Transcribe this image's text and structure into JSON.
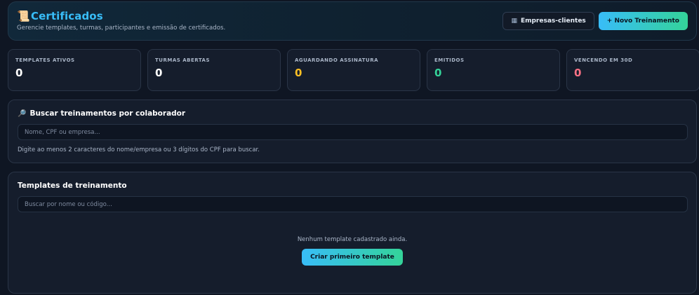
{
  "header": {
    "icon": "scroll-icon",
    "title": "Certificados",
    "subtitle": "Gerencie templates, turmas, participantes e emissão de certificados.",
    "clients_button_icon": "building-icon",
    "clients_button": "Empresas-clientes",
    "new_training_button": "+ Novo Treinamento"
  },
  "stats": [
    {
      "label": "TEMPLATES ATIVOS",
      "value": "0",
      "color": "#ffffff"
    },
    {
      "label": "TURMAS ABERTAS",
      "value": "0",
      "color": "#ffffff"
    },
    {
      "label": "AGUARDANDO ASSINATURA",
      "value": "0",
      "color": "#fbbf24"
    },
    {
      "label": "EMITIDOS",
      "value": "0",
      "color": "#34d399"
    },
    {
      "label": "VENCENDO EM 30D",
      "value": "0",
      "color": "#fb7185"
    }
  ],
  "search": {
    "icon": "magnifier-icon",
    "title": "Buscar treinamentos por colaborador",
    "placeholder": "Nome, CPF ou empresa...",
    "hint": "Digite ao menos 2 caracteres do nome/empresa ou 3 dígitos do CPF para buscar."
  },
  "templates": {
    "title": "Templates de treinamento",
    "placeholder": "Buscar por nome ou código...",
    "empty_text": "Nenhum template cadastrado ainda.",
    "create_button": "Criar primeiro template"
  },
  "colors": {
    "accent": "#38bdf8",
    "accent_2": "#34d399",
    "background": "#0f1623",
    "card": "#151d2c"
  }
}
